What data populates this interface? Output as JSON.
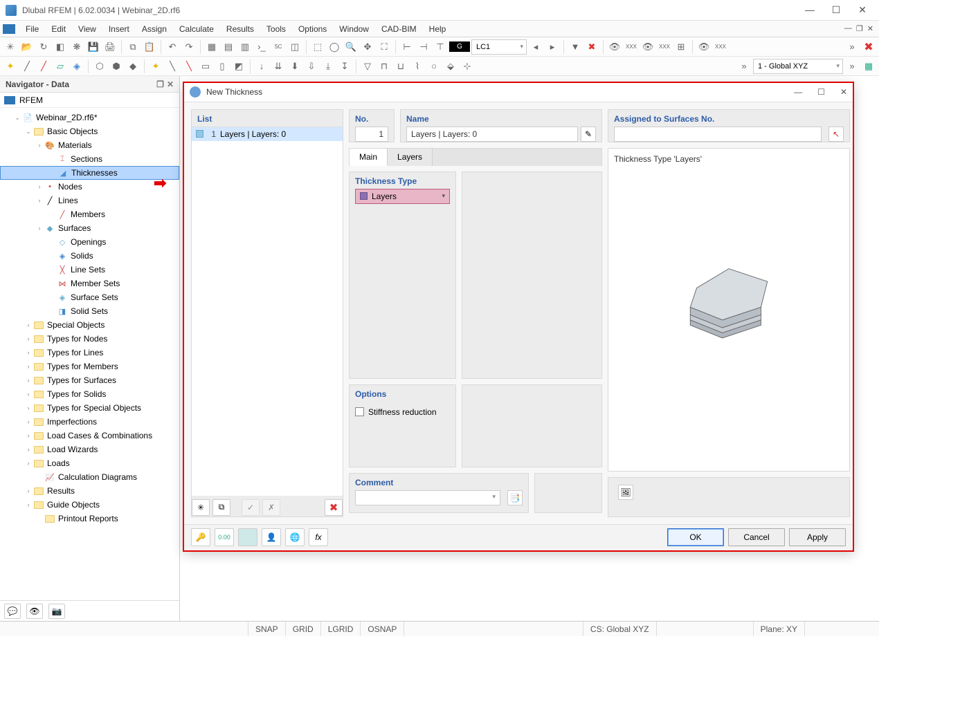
{
  "app": {
    "title": "Dlubal RFEM | 6.02.0034 | Webinar_2D.rf6"
  },
  "menus": [
    "File",
    "Edit",
    "View",
    "Insert",
    "Assign",
    "Calculate",
    "Results",
    "Tools",
    "Options",
    "Window",
    "CAD-BIM",
    "Help"
  ],
  "toolbar": {
    "cs_dropdown": "1 - Global XYZ",
    "lc_label": "G",
    "lc_dropdown": "LC1"
  },
  "navigator": {
    "title": "Navigator - Data",
    "root": "RFEM",
    "project": "Webinar_2D.rf6*",
    "basic_objects": "Basic Objects",
    "items": {
      "materials": "Materials",
      "sections": "Sections",
      "thicknesses": "Thicknesses",
      "nodes": "Nodes",
      "lines": "Lines",
      "members": "Members",
      "surfaces": "Surfaces",
      "openings": "Openings",
      "solids": "Solids",
      "linesets": "Line Sets",
      "membersets": "Member Sets",
      "surfacesets": "Surface Sets",
      "solidsets": "Solid Sets"
    },
    "groups": [
      "Special Objects",
      "Types for Nodes",
      "Types for Lines",
      "Types for Members",
      "Types for Surfaces",
      "Types for Solids",
      "Types for Special Objects",
      "Imperfections",
      "Load Cases & Combinations",
      "Load Wizards",
      "Loads",
      "Calculation Diagrams",
      "Results",
      "Guide Objects",
      "Printout Reports"
    ]
  },
  "dialog": {
    "title": "New Thickness",
    "list_hdr": "List",
    "list_item_idx": "1",
    "list_item_label": "Layers | Layers: 0",
    "no_hdr": "No.",
    "no_val": "1",
    "name_hdr": "Name",
    "name_val": "Layers | Layers: 0",
    "assigned_hdr": "Assigned to Surfaces No.",
    "tab_main": "Main",
    "tab_layers": "Layers",
    "type_hdr": "Thickness Type",
    "type_val": "Layers",
    "options_hdr": "Options",
    "stiffness": "Stiffness reduction",
    "comment_hdr": "Comment",
    "preview_hdr": "Thickness Type  'Layers'",
    "btn_ok": "OK",
    "btn_cancel": "Cancel",
    "btn_apply": "Apply"
  },
  "status": {
    "snap": "SNAP",
    "grid": "GRID",
    "lgrid": "LGRID",
    "osnap": "OSNAP",
    "cs": "CS: Global XYZ",
    "plane": "Plane: XY"
  }
}
